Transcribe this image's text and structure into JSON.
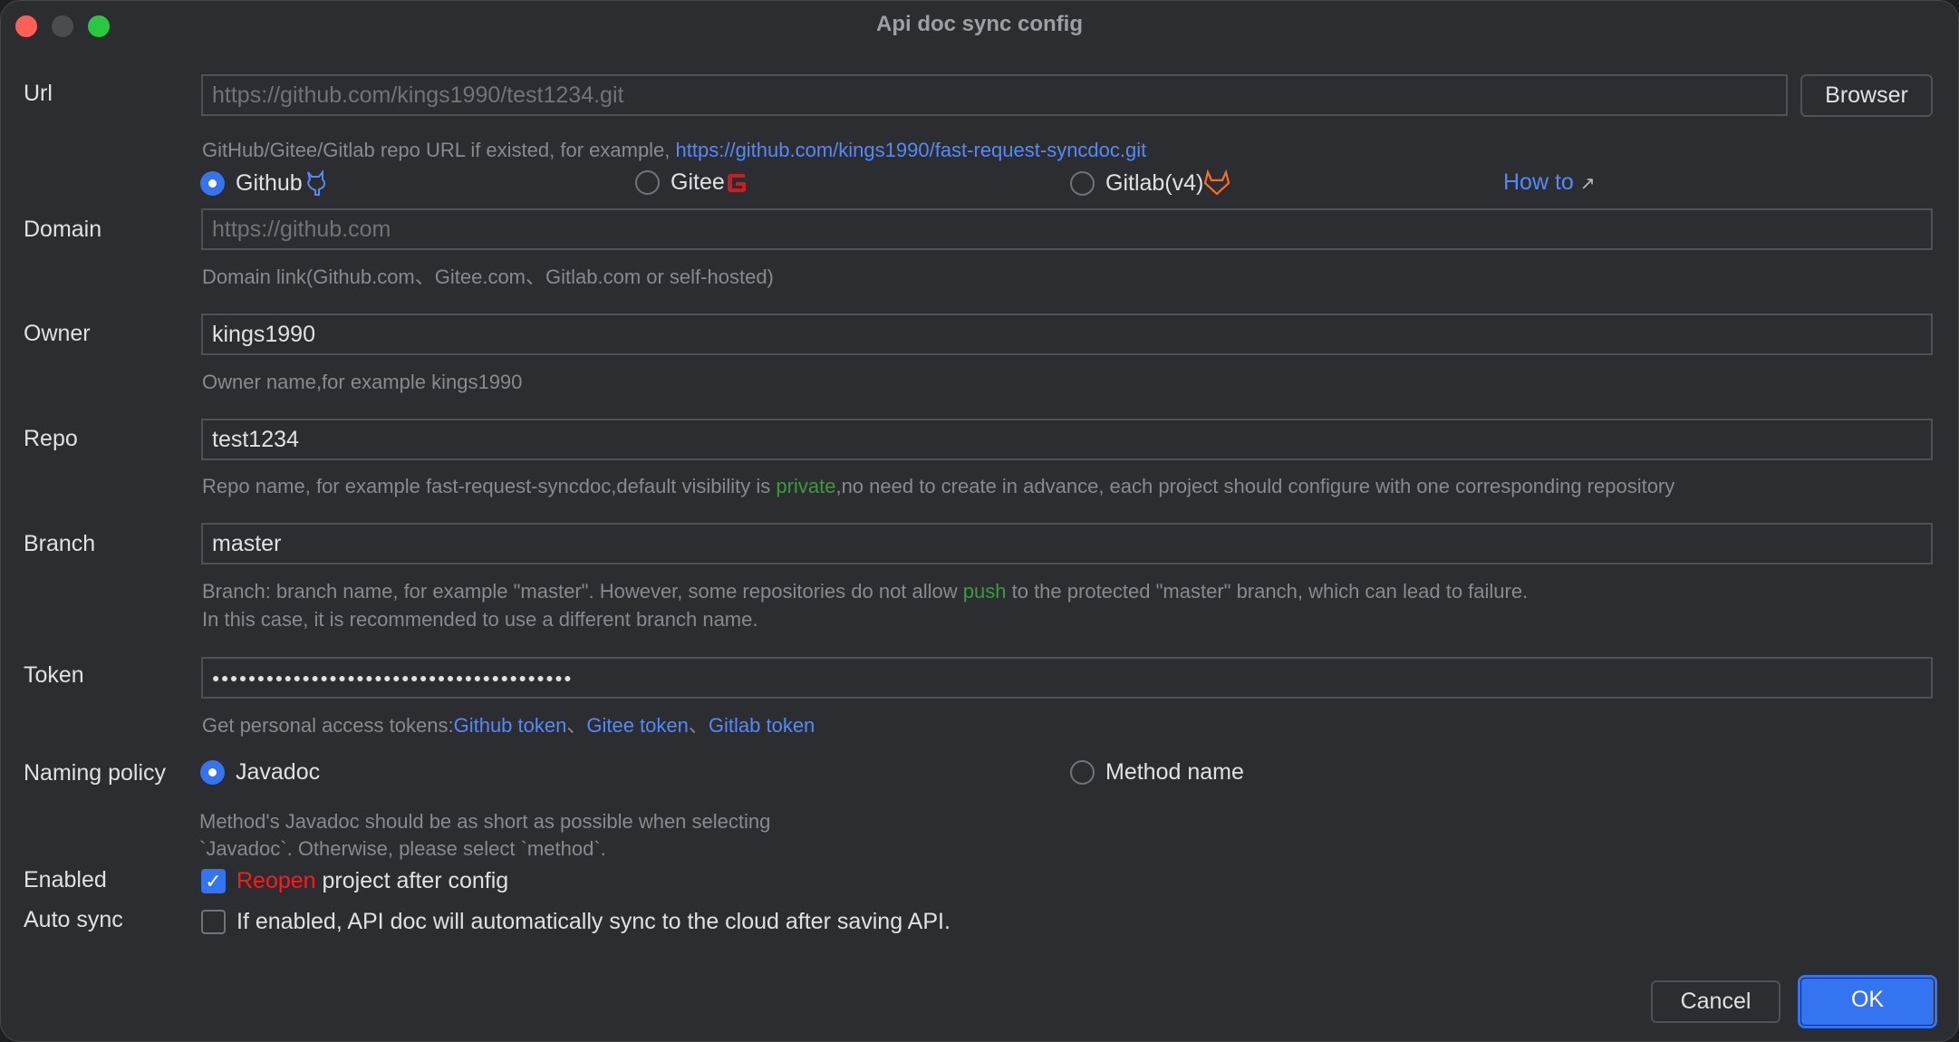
{
  "window": {
    "title": "Api doc sync config"
  },
  "url": {
    "label": "Url",
    "placeholder": "https://github.com/kings1990/test1234.git",
    "browse_label": "Browser",
    "hint_prefix": "GitHub/Gitee/Gitlab repo URL if existed, for example, ",
    "hint_link": "https://github.com/kings1990/fast-request-syncdoc.git"
  },
  "provider": {
    "options": [
      {
        "label": "Github",
        "icon": "github-icon",
        "selected": true
      },
      {
        "label": "Gitee",
        "icon": "gitee-icon",
        "selected": false
      },
      {
        "label": "Gitlab(v4)",
        "icon": "gitlab-icon",
        "selected": false
      }
    ],
    "how_to": "How to",
    "how_to_arrow": "↗"
  },
  "domain": {
    "label": "Domain",
    "placeholder": "https://github.com",
    "hint": "Domain link(Github.com、Gitee.com、Gitlab.com or self-hosted)"
  },
  "owner": {
    "label": "Owner",
    "value": "kings1990",
    "hint": "Owner name,for example kings1990"
  },
  "repo": {
    "label": "Repo",
    "value": "test1234",
    "hint_a": "Repo name, for example fast-request-syncdoc,default visibility is ",
    "hint_green": "private",
    "hint_b": ",no need to create in advance, each project should configure with one corresponding repository"
  },
  "branch": {
    "label": "Branch",
    "value": "master",
    "hint1_a": "Branch: branch name, for example \"master\". However, some repositories do not allow ",
    "hint1_green": "push",
    "hint1_b": " to the protected \"master\" branch, which can lead to failure.",
    "hint2": "In this case, it is recommended to use a different branch name."
  },
  "token": {
    "label": "Token",
    "value": "●●●●●●●●●●●●●●●●●●●●●●●●●●●●●●●●●●●●●●●●",
    "hint_prefix": "Get personal access tokens:",
    "links": [
      "Github token",
      "Gitee token",
      "Gitlab token"
    ],
    "sep": "、"
  },
  "naming": {
    "label": "Naming policy",
    "options": [
      {
        "label": "Javadoc",
        "selected": true
      },
      {
        "label": "Method name",
        "selected": false
      }
    ],
    "hint1": "Method's Javadoc should be as short as possible when selecting",
    "hint2": "`Javadoc`. Otherwise, please select `method`."
  },
  "enabled": {
    "label": "Enabled",
    "checked": true,
    "text_red": "Reopen",
    "text": " project after config"
  },
  "auto_sync": {
    "label": "Auto sync",
    "checked": false,
    "text": "If enabled, API doc will automatically sync to the cloud after saving API."
  },
  "buttons": {
    "cancel": "Cancel",
    "ok": "OK"
  },
  "colors": {
    "accent": "#3574f0",
    "link": "#548af7",
    "green": "#3b9c3b",
    "red": "#ff1a1a"
  }
}
